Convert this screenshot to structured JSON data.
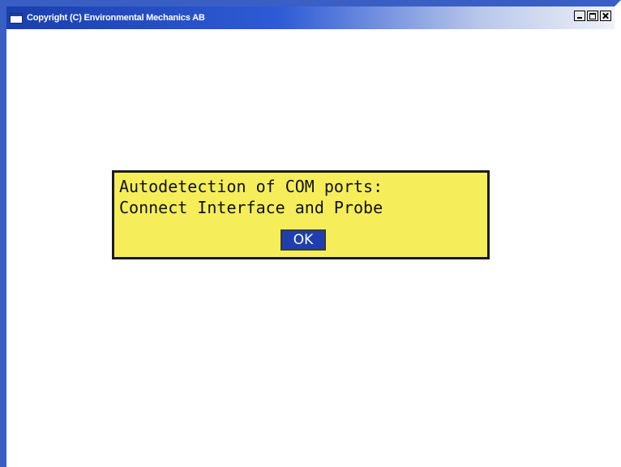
{
  "window": {
    "title": "Copyright (C) Environmental Mechanics AB",
    "controls": {
      "minimize_icon": "minimize-icon",
      "maximize_icon": "maximize-icon",
      "close_icon": "close-icon"
    },
    "colors": {
      "titlebar_start": "#1a3fae",
      "titlebar_end": "#eef1f8",
      "background": "#ffffff"
    }
  },
  "dialog": {
    "line1": "Autodetection of COM ports:",
    "line2": "Connect Interface and Probe",
    "ok_label": "OK",
    "colors": {
      "background": "#f5ee5a",
      "ok_button": "#1f3fb0"
    }
  }
}
